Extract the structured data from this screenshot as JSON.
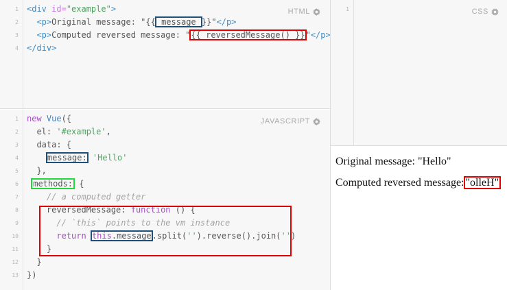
{
  "html_pane": {
    "label": "HTML",
    "line_numbers": [
      "1",
      "2",
      "3",
      "4"
    ],
    "code": {
      "l1_open": "<div ",
      "l1_attr": "id=",
      "l1_val": "\"example\"",
      "l1_close": ">",
      "l2_open": "  <p>",
      "l2_text": "Original message: \"{{",
      "l2_box": " message ",
      "l2_end": "}}\"",
      "l2_close": "</p>",
      "l3_open": "  <p>",
      "l3_text": "Computed reversed message: \"",
      "l3_box": "{{ reversedMessage() }}",
      "l3_end": "\"",
      "l3_close": "</p>",
      "l4": "</div>"
    }
  },
  "css_pane": {
    "label": "CSS",
    "line_numbers": [
      "1"
    ]
  },
  "js_pane": {
    "label": "JAVASCRIPT",
    "line_numbers": [
      "1",
      "2",
      "3",
      "4",
      "5",
      "6",
      "7",
      "8",
      "9",
      "10",
      "11",
      "12",
      "13"
    ],
    "code": {
      "l1_kw": "new ",
      "l1_fn": "Vue",
      "l1_rest": "({",
      "l2_prop": "  el: ",
      "l2_str": "'#example'",
      "l2_rest": ",",
      "l3": "  data: {",
      "l4_box": "message:",
      "l4_str": " 'Hello'",
      "l5": "  },",
      "l6_box": "methods:",
      "l6_rest": " {",
      "l7": "    // a computed getter",
      "l8_fn": "reversedMessage",
      "l8_colon": ": ",
      "l8_kw": "function",
      "l8_rest": " () {",
      "l9": "      // `this` points to the vm instance",
      "l10_kw": "return ",
      "l10_box_kw": "this",
      "l10_box_rest": ".message",
      "l10_a": ".split(",
      "l10_s1": "''",
      "l10_b": ").reverse().join(",
      "l10_s2": "''",
      "l10_c": ")",
      "l11": "    }",
      "l12": "  }",
      "l13": "})"
    }
  },
  "output": {
    "line1": "Original message: \"Hello\"",
    "line2_label": "Computed reversed message:",
    "line2_value": "\"olleH\""
  },
  "colors": {
    "highlight_blue": "#1f4e79",
    "highlight_red": "#e00000",
    "highlight_green": "#22d93b"
  }
}
